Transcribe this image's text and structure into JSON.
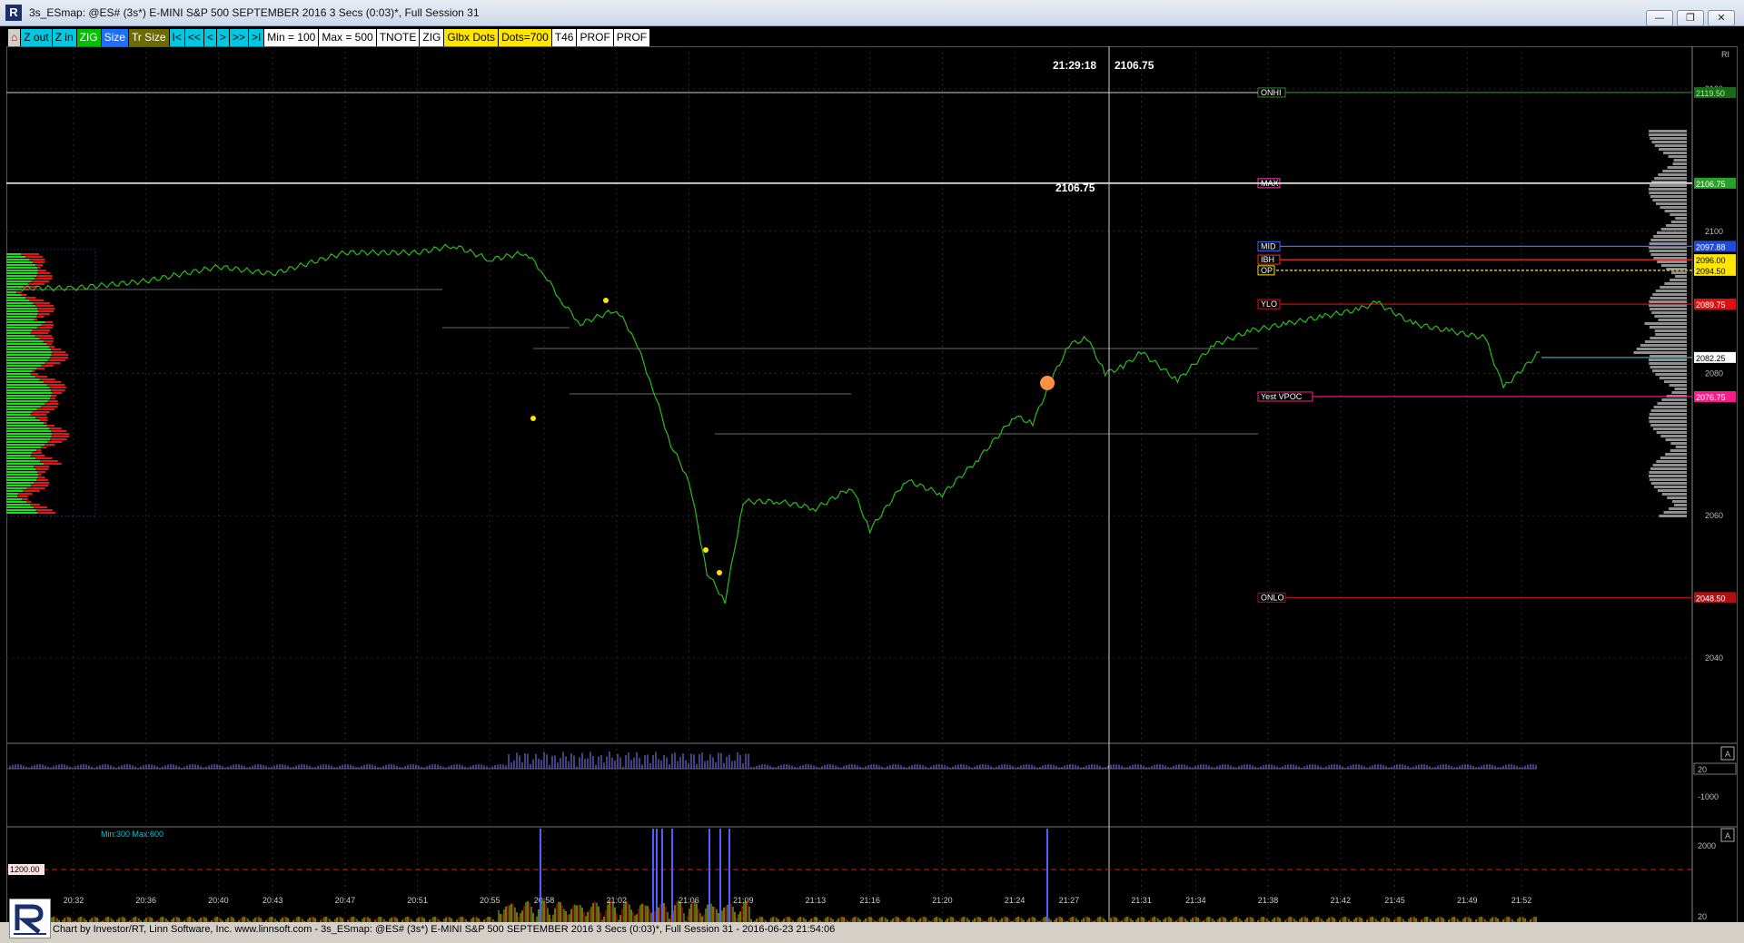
{
  "window": {
    "title": "3s_ESmap: @ES# (3s*) E-MINI S&P 500 SEPTEMBER 2016 3 Secs (0:03)*, Full Session 31",
    "app_logo": "R",
    "buttons": {
      "minimize": "—",
      "restore": "❐",
      "close": "✕"
    }
  },
  "toolbar": {
    "items": [
      {
        "label": "⌂",
        "bg": "#d4d0c8",
        "fg": "#b00000"
      },
      {
        "label": "Z out",
        "bg": "#00c8e0",
        "fg": "#000"
      },
      {
        "label": "Z in",
        "bg": "#00c8e0",
        "fg": "#000"
      },
      {
        "label": "ZIG",
        "bg": "#00c000",
        "fg": "#fff"
      },
      {
        "label": "Size",
        "bg": "#1e6fff",
        "fg": "#fff"
      },
      {
        "label": "Tr Size",
        "bg": "#6b6b00",
        "fg": "#fff"
      },
      {
        "label": "I<",
        "bg": "#00c8e0",
        "fg": "#000"
      },
      {
        "label": "<<",
        "bg": "#00c8e0",
        "fg": "#000"
      },
      {
        "label": "<",
        "bg": "#00c8e0",
        "fg": "#000"
      },
      {
        "label": ">",
        "bg": "#00c8e0",
        "fg": "#000"
      },
      {
        "label": ">>",
        "bg": "#00c8e0",
        "fg": "#000"
      },
      {
        "label": ">I",
        "bg": "#00c8e0",
        "fg": "#000"
      },
      {
        "label": "Min = 100",
        "bg": "#ffffff",
        "fg": "#000"
      },
      {
        "label": "Max = 500",
        "bg": "#ffffff",
        "fg": "#000"
      },
      {
        "label": "TNOTE",
        "bg": "#ffffff",
        "fg": "#000"
      },
      {
        "label": "ZIG",
        "bg": "#ffffff",
        "fg": "#000"
      },
      {
        "label": "Glbx Dots",
        "bg": "#ffe600",
        "fg": "#000"
      },
      {
        "label": "Dots=700",
        "bg": "#ffe600",
        "fg": "#000"
      },
      {
        "label": "T46",
        "bg": "#ffffff",
        "fg": "#000"
      },
      {
        "label": "PROF",
        "bg": "#ffffff",
        "fg": "#000"
      },
      {
        "label": "PROF",
        "bg": "#ffffff",
        "fg": "#000"
      }
    ]
  },
  "crosshair": {
    "time": "21:29:18",
    "price": "2106.75",
    "level_label": "2106.75"
  },
  "y_axis": {
    "ticks": [
      2120,
      2100,
      2080,
      2060,
      2040
    ],
    "corner_label": "RI"
  },
  "x_axis": {
    "ticks": [
      "20:32",
      "20:36",
      "20:40",
      "20:43",
      "20:47",
      "20:51",
      "20:55",
      "20:58",
      "21:02",
      "21:06",
      "21:09",
      "21:13",
      "21:16",
      "21:20",
      "21:24",
      "21:27",
      "21:31",
      "21:34",
      "21:38",
      "21:42",
      "21:45",
      "21:49",
      "21:52"
    ]
  },
  "levels": [
    {
      "name": "ONHI",
      "price": "2119.50",
      "color": "#2e8b2e",
      "tag_fg": "#ffffff",
      "price_bg": "#1a6a1a",
      "price_fg": "#9f9"
    },
    {
      "name": "MAX",
      "price": "2106.75",
      "color": "#ff3cae",
      "tag_fg": "#ffffff",
      "price_bg": "#2aa02a",
      "price_fg": "#fff"
    },
    {
      "name": "MID",
      "price": "2097.88",
      "color": "#3a6cff",
      "tag_fg": "#ffffff",
      "price_bg": "#1f4bd8",
      "price_fg": "#fff"
    },
    {
      "name": "IBH",
      "price": "2096.00",
      "color": "#ff2a2a",
      "tag_fg": "#000000",
      "price_bg": "#ffe600",
      "price_fg": "#000"
    },
    {
      "name": "OP",
      "price": "2094.50",
      "color": "#ffe600",
      "tag_fg": "#000000",
      "price_bg": "#ffe600",
      "price_fg": "#000"
    },
    {
      "name": "YLO",
      "price": "2089.75",
      "color": "#e01010",
      "tag_fg": "#ffffff",
      "price_bg": "#e01010",
      "price_fg": "#fff"
    },
    {
      "name": "Yest VPOC",
      "price": "2076.75",
      "color": "#ff1a8c",
      "tag_fg": "#ffffff",
      "price_bg": "#ff1a8c",
      "price_fg": "#fff"
    },
    {
      "name": "ONLO",
      "price": "2048.50",
      "color": "#b01010",
      "tag_fg": "#ffffff",
      "price_bg": "#b01010",
      "price_fg": "#fff"
    }
  ],
  "last_price": "2082.25",
  "volume_panel": {
    "scale_top": "20",
    "scale_bottom": "-1000",
    "marker": "A"
  },
  "volume_panel2": {
    "label": "Min:300 Max:600",
    "threshold": "1200.00",
    "scale_top": "2000",
    "scale_bottom": "20",
    "marker": "A"
  },
  "footer": {
    "text": "Chart by Investor/RT, Linn Software, Inc. www.linnsoft.com - 3s_ESmap: @ES# (3s*) E-MINI S&P 500 SEPTEMBER 2016 3 Secs (0:03)*, Full Session 31 - 2016-06-23 21:54:06"
  },
  "chart_data": {
    "type": "line",
    "title": "",
    "xlabel": "",
    "ylabel": "",
    "ylim": [
      2028,
      2126
    ],
    "x": [
      "20:29",
      "20:32",
      "20:36",
      "20:40",
      "20:43",
      "20:47",
      "20:51",
      "20:53",
      "20:55",
      "20:57",
      "20:58",
      "20:59",
      "21:00",
      "21:02",
      "21:03",
      "21:04",
      "21:05",
      "21:06",
      "21:07",
      "21:08",
      "21:09",
      "21:11",
      "21:13",
      "21:15",
      "21:16",
      "21:18",
      "21:20",
      "21:22",
      "21:24",
      "21:25",
      "21:26",
      "21:27",
      "21:28",
      "21:29",
      "21:30",
      "21:31",
      "21:33",
      "21:35",
      "21:37",
      "21:39",
      "21:41",
      "21:43",
      "21:44",
      "21:46",
      "21:48",
      "21:50",
      "21:51",
      "21:53"
    ],
    "series": [
      {
        "values": [
          2092,
          2092,
          2093,
          2095,
          2094,
          2097,
          2097,
          2098,
          2096,
          2097,
          2094,
          2090,
          2087,
          2089,
          2085,
          2078,
          2070,
          2065,
          2052,
          2048,
          2062,
          2062,
          2061,
          2064,
          2058,
          2065,
          2063,
          2068,
          2074,
          2073,
          2079,
          2084,
          2085,
          2080,
          2081,
          2083,
          2079,
          2084,
          2086,
          2087,
          2088,
          2089,
          2090,
          2087,
          2086,
          2085,
          2078,
          2083
        ]
      }
    ],
    "grid": true,
    "legend": "none"
  }
}
